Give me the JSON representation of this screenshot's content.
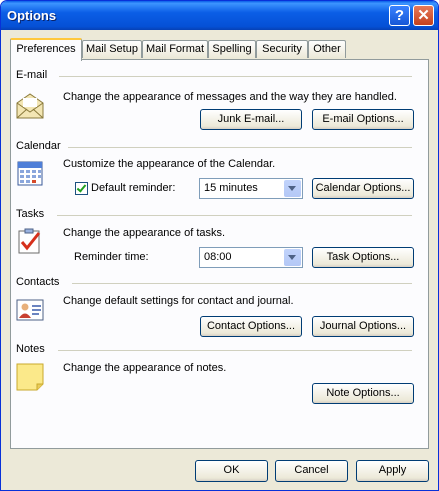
{
  "window": {
    "title": "Options"
  },
  "tabs": [
    "Preferences",
    "Mail Setup",
    "Mail Format",
    "Spelling",
    "Security",
    "Other"
  ],
  "email": {
    "header": "E-mail",
    "description": "Change the appearance of messages and the way they are handled.",
    "junk_button": "Junk E-mail...",
    "options_button": "E-mail Options..."
  },
  "calendar": {
    "header": "Calendar",
    "description": "Customize the appearance of the Calendar.",
    "reminder_label": "Default reminder:",
    "reminder_checked": true,
    "reminder_value": "15 minutes",
    "options_button": "Calendar Options..."
  },
  "tasks": {
    "header": "Tasks",
    "description": "Change the appearance of tasks.",
    "reminder_label": "Reminder time:",
    "reminder_value": "08:00",
    "options_button": "Task Options..."
  },
  "contacts": {
    "header": "Contacts",
    "description": "Change default settings for contact and journal.",
    "contact_button": "Contact Options...",
    "journal_button": "Journal Options..."
  },
  "notes": {
    "header": "Notes",
    "description": "Change the appearance of notes.",
    "options_button": "Note Options..."
  },
  "footer": {
    "ok": "OK",
    "cancel": "Cancel",
    "apply": "Apply"
  }
}
